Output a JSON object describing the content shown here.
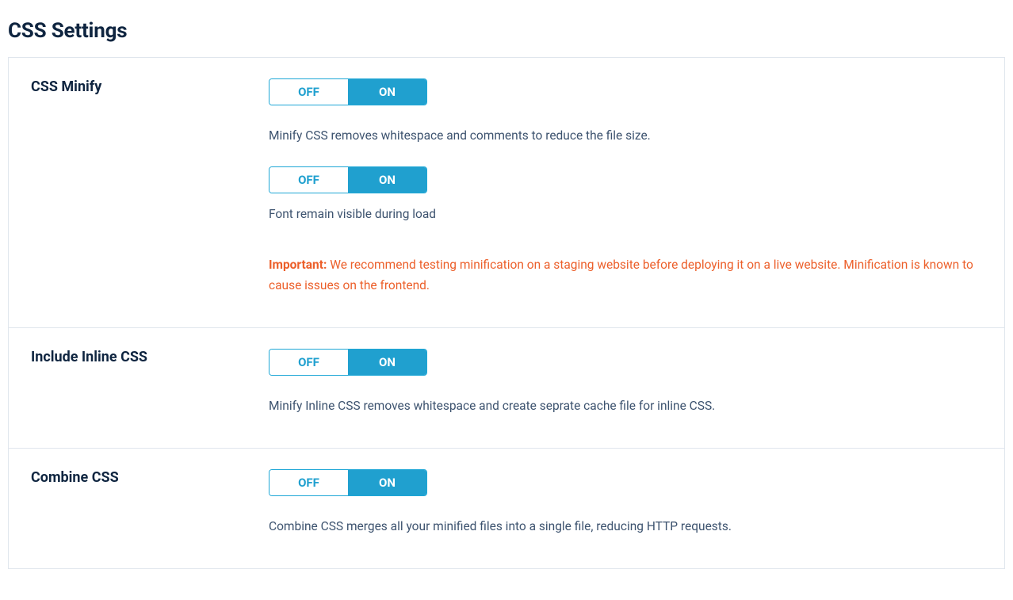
{
  "page": {
    "title": "CSS Settings"
  },
  "toggleLabels": {
    "off": "OFF",
    "on": "ON"
  },
  "settings": {
    "cssMinify": {
      "label": "CSS Minify",
      "toggle1": {
        "state": "on"
      },
      "desc1": "Minify CSS removes whitespace and comments to reduce the file size.",
      "toggle2": {
        "state": "on"
      },
      "desc2": "Font remain visible during load",
      "warning": {
        "important": "Important:",
        "text": "We recommend testing minification on a staging website before deploying it on a live website. Minification is known to cause issues on the frontend."
      }
    },
    "includeInlineCss": {
      "label": "Include Inline CSS",
      "toggle": {
        "state": "on"
      },
      "desc": "Minify Inline CSS removes whitespace and create seprate cache file for inline CSS."
    },
    "combineCss": {
      "label": "Combine CSS",
      "toggle": {
        "state": "on"
      },
      "desc": "Combine CSS merges all your minified files into a single file, reducing HTTP requests."
    }
  }
}
